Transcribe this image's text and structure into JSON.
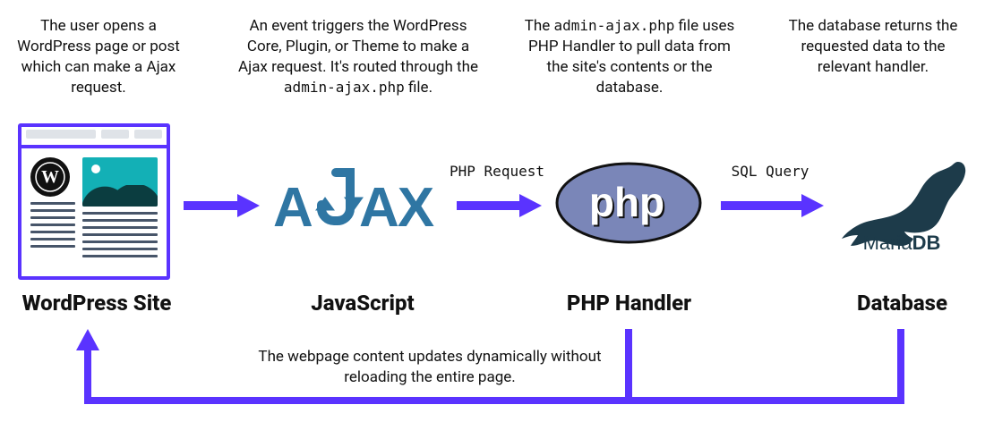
{
  "colors": {
    "accent": "#5a33ff"
  },
  "nodes": {
    "wp": {
      "title": "WordPress Site"
    },
    "js": {
      "title": "JavaScript"
    },
    "php": {
      "title": "PHP Handler"
    },
    "db": {
      "title": "Database"
    }
  },
  "descriptions": {
    "wp_pre": "The user opens a WordPress page or post which can make a Ajax request.",
    "js_pre": "An event triggers the WordPress Core, Plugin, or Theme to make a Ajax request. It's routed through the ",
    "js_code": "admin-ajax.php",
    "js_post": " file.",
    "php_pre": "The ",
    "php_code": "admin-ajax.php",
    "php_post": " file uses PHP Handler to pull data from the site's contents or the database.",
    "db_pre": "The database returns the requested data to the relevant handler."
  },
  "arrows": {
    "b_label": "PHP Request",
    "c_label": "SQL Query"
  },
  "feedback_text": "The webpage content updates dynamically without reloading the entire page.",
  "logos": {
    "ajax_text": "A AX",
    "php_text": "php",
    "mariadb_text": "MariaDB",
    "wp_glyph": "W"
  },
  "icon_names": {
    "wp": "wordpress-icon",
    "ajax": "ajax-icon",
    "php": "php-icon",
    "mariadb": "mariadb-icon",
    "arrow": "arrow-right-icon",
    "feedback": "feedback-arrow-icon"
  }
}
